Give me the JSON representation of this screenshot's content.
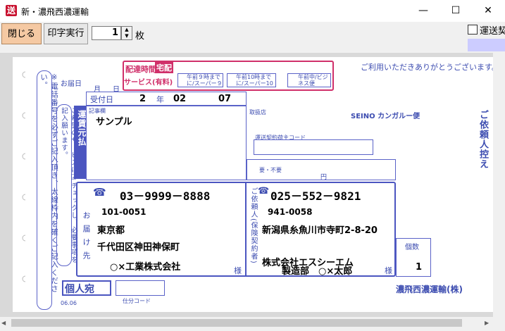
{
  "window": {
    "title": "新・濃飛西濃運輸",
    "icon_label": "送",
    "minimize_glyph": "—",
    "maximize_glyph": "☐",
    "close_glyph": "✕"
  },
  "toolbar": {
    "close_label": "閉じる",
    "print_label": "印字実行",
    "copies_value": "1",
    "copies_unit": "枚",
    "checkbox_label": "運送契",
    "accent": "#ccccff"
  },
  "slip": {
    "side_note": "※電話番号を必ずご記入頂き、太線枠内を確くご記入ください。",
    "service_note": "ご希望のサービスに☑チェックし、必要事項を記入願います。",
    "delivery_label": "お届日",
    "month_label": "月",
    "day_label": "日",
    "time_label": "配達時間",
    "time_badge": "宅配",
    "service_label": "サービス(有料)",
    "opt_9": "午前９時までに/スーパー９",
    "opt_10": "午前10時までに/スーパー10",
    "opt_am": "午前中/ビジネス便",
    "thanks": "ご利用いただきありがとうございます。",
    "accept_label": "受付日",
    "accept_year": "2",
    "year_label": "年",
    "accept_month": "02",
    "accept_day": "07",
    "article_label": "記事欄",
    "article_value": "サンプル",
    "freight_label": "運賃元払",
    "branch_label": "取扱店",
    "contract_label": "運送契約荷主コード",
    "brand": "SEINO カンガルー便",
    "request_copy": "ご依頼人控え",
    "insurance_label": "要・不要",
    "yen": "円",
    "consignee_phone": "03－9999－8888",
    "consignee_zip": "101-0051",
    "consignee_addr1": "東京都",
    "consignee_addr2": "千代田区神田神保町",
    "consignee_name": "○×工業株式会社",
    "consignee_side": "お届け先",
    "sama": "様",
    "shipper_label": "ご依頼人(保険契約者)",
    "shipper_phone": "025－552－9821",
    "shipper_zip": "941-0058",
    "shipper_addr": "新潟県糸魚川市寺町2-8-20",
    "shipper_name1": "株式会社エスシーエム",
    "shipper_name2": "製造部　○×太郎",
    "count_label": "個数",
    "count_value": "1",
    "personal": "個人宛",
    "carrier": "濃飛西濃運輸(株)",
    "tel_icon": "☎",
    "code_label": "仕分コード",
    "form_no": "06.06"
  }
}
